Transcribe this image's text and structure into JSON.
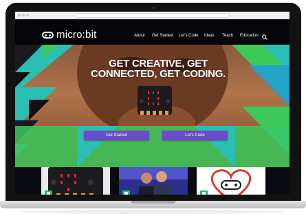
{
  "site": {
    "logo_text": "micro:bit",
    "nav": [
      "About",
      "Get Started",
      "Let's Code",
      "Ideas",
      "Teach",
      "Education"
    ]
  },
  "hero": {
    "title": "GET CREATIVE, GET CONNECTED, GET CODING.",
    "buttons": [
      "Get Started",
      "Let's Code"
    ]
  },
  "colors": {
    "accent_purple": "#6c4bc8",
    "teal": "#2bbfb4",
    "green": "#3cc95c",
    "dark": "#07070b"
  },
  "icons": [
    "search-icon",
    "logo-icon",
    "heart-icon",
    "document-icon"
  ]
}
